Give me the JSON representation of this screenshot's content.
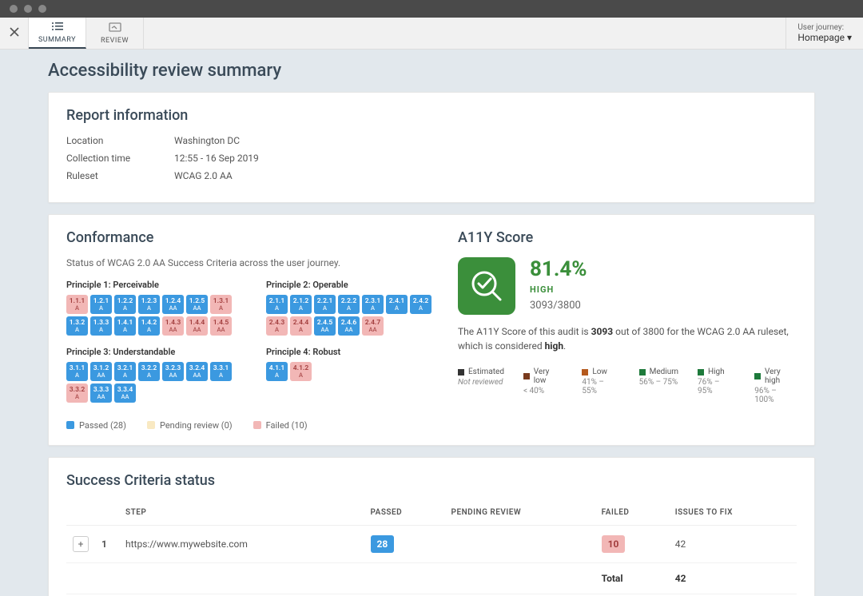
{
  "tabs": {
    "summary": "SUMMARY",
    "review": "REVIEW"
  },
  "user_journey": {
    "label": "User journey:",
    "value": "Homepage"
  },
  "page_title": "Accessibility review summary",
  "report_info": {
    "heading": "Report information",
    "rows": [
      {
        "label": "Location",
        "value": "Washington DC"
      },
      {
        "label": "Collection time",
        "value": "12:55 - 16 Sep 2019"
      },
      {
        "label": "Ruleset",
        "value": "WCAG 2.0 AA"
      }
    ]
  },
  "conformance": {
    "heading": "Conformance",
    "subtext": "Status of WCAG 2.0 AA Success Criteria across the user journey.",
    "principles": [
      {
        "title": "Principle 1: Perceivable",
        "criteria": [
          {
            "num": "1.1.1",
            "lvl": "A",
            "status": "failed"
          },
          {
            "num": "1.2.1",
            "lvl": "A",
            "status": "passed"
          },
          {
            "num": "1.2.2",
            "lvl": "A",
            "status": "passed"
          },
          {
            "num": "1.2.3",
            "lvl": "A",
            "status": "passed"
          },
          {
            "num": "1.2.4",
            "lvl": "AA",
            "status": "passed"
          },
          {
            "num": "1.2.5",
            "lvl": "AA",
            "status": "passed"
          },
          {
            "num": "1.3.1",
            "lvl": "A",
            "status": "failed"
          },
          {
            "num": "1.3.2",
            "lvl": "A",
            "status": "passed"
          },
          {
            "num": "1.3.3",
            "lvl": "A",
            "status": "passed"
          },
          {
            "num": "1.4.1",
            "lvl": "A",
            "status": "passed"
          },
          {
            "num": "1.4.2",
            "lvl": "A",
            "status": "passed"
          },
          {
            "num": "1.4.3",
            "lvl": "AA",
            "status": "failed"
          },
          {
            "num": "1.4.4",
            "lvl": "AA",
            "status": "failed"
          },
          {
            "num": "1.4.5",
            "lvl": "AA",
            "status": "failed"
          }
        ]
      },
      {
        "title": "Principle 2: Operable",
        "criteria": [
          {
            "num": "2.1.1",
            "lvl": "A",
            "status": "passed"
          },
          {
            "num": "2.1.2",
            "lvl": "A",
            "status": "passed"
          },
          {
            "num": "2.2.1",
            "lvl": "A",
            "status": "passed"
          },
          {
            "num": "2.2.2",
            "lvl": "A",
            "status": "passed"
          },
          {
            "num": "2.3.1",
            "lvl": "A",
            "status": "passed"
          },
          {
            "num": "2.4.1",
            "lvl": "A",
            "status": "passed"
          },
          {
            "num": "2.4.2",
            "lvl": "A",
            "status": "passed"
          },
          {
            "num": "2.4.3",
            "lvl": "A",
            "status": "failed"
          },
          {
            "num": "2.4.4",
            "lvl": "A",
            "status": "failed"
          },
          {
            "num": "2.4.5",
            "lvl": "AA",
            "status": "passed"
          },
          {
            "num": "2.4.6",
            "lvl": "AA",
            "status": "passed"
          },
          {
            "num": "2.4.7",
            "lvl": "AA",
            "status": "failed"
          }
        ]
      },
      {
        "title": "Principle 3: Understandable",
        "criteria": [
          {
            "num": "3.1.1",
            "lvl": "A",
            "status": "passed"
          },
          {
            "num": "3.1.2",
            "lvl": "AA",
            "status": "passed"
          },
          {
            "num": "3.2.1",
            "lvl": "A",
            "status": "passed"
          },
          {
            "num": "3.2.2",
            "lvl": "A",
            "status": "passed"
          },
          {
            "num": "3.2.3",
            "lvl": "AA",
            "status": "passed"
          },
          {
            "num": "3.2.4",
            "lvl": "AA",
            "status": "passed"
          },
          {
            "num": "3.3.1",
            "lvl": "A",
            "status": "passed"
          },
          {
            "num": "3.3.2",
            "lvl": "A",
            "status": "failed"
          },
          {
            "num": "3.3.3",
            "lvl": "AA",
            "status": "passed"
          },
          {
            "num": "3.3.4",
            "lvl": "AA",
            "status": "passed"
          }
        ]
      },
      {
        "title": "Principle 4: Robust",
        "criteria": [
          {
            "num": "4.1.1",
            "lvl": "A",
            "status": "passed"
          },
          {
            "num": "4.1.2",
            "lvl": "A",
            "status": "failed"
          }
        ]
      }
    ],
    "legend": {
      "passed": "Passed (28)",
      "pending": "Pending review (0)",
      "failed": "Failed (10)"
    }
  },
  "a11y": {
    "heading": "A11Y Score",
    "pct": "81.4%",
    "label": "HIGH",
    "fraction": "3093/3800",
    "para_pre": "The A11Y Score of this audit is ",
    "para_score": "3093",
    "para_mid": " out of 3800 for the WCAG 2.0 AA ruleset, which is considered ",
    "para_level": "high",
    "para_post": ".",
    "legend": [
      {
        "name": "Estimated",
        "range": "Not reviewed",
        "color": "#333",
        "italic": true
      },
      {
        "name": "Very low",
        "range": "< 40%",
        "color": "#7a3b1e"
      },
      {
        "name": "Low",
        "range": "41% – 55%",
        "color": "#b55a1e"
      },
      {
        "name": "Medium",
        "range": "56% – 75%",
        "color": "#1e7a3b"
      },
      {
        "name": "High",
        "range": "76% – 95%",
        "color": "#1e7a3b"
      },
      {
        "name": "Very high",
        "range": "96% – 100%",
        "color": "#1e7a3b"
      }
    ]
  },
  "status": {
    "heading": "Success Criteria status",
    "columns": [
      "",
      "",
      "STEP",
      "PASSED",
      "PENDING REVIEW",
      "FAILED",
      "ISSUES TO FIX"
    ],
    "rows": [
      {
        "num": "1",
        "step": "https://www.mywebsite.com",
        "passed": "28",
        "pending": "",
        "failed": "10",
        "issues": "42"
      }
    ],
    "total": {
      "label": "Total",
      "issues": "42"
    }
  }
}
